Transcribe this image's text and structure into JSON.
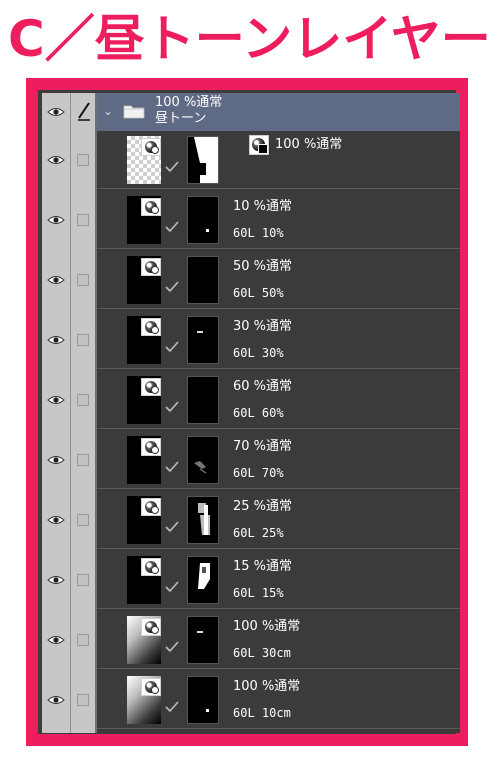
{
  "heading": "C／昼トーンレイヤー",
  "colors": {
    "accent": "#ee1e5e",
    "panel_bg": "#3b3b3b",
    "folder_bg": "#5f6a85"
  },
  "folder": {
    "opacity_mode": "100 %通常",
    "name": "昼トーン",
    "expanded": true
  },
  "layers": [
    {
      "line1": "100 %通常",
      "line2": "",
      "thumb": "checker",
      "mask": "fig1"
    },
    {
      "line1": "10 %通常",
      "line2": "60L 10%",
      "thumb": "black",
      "mask": "dot"
    },
    {
      "line1": "50 %通常",
      "line2": "60L 50%",
      "thumb": "black",
      "mask": "empty"
    },
    {
      "line1": "30 %通常",
      "line2": "60L 30%",
      "thumb": "black",
      "mask": "dash"
    },
    {
      "line1": "60 %通常",
      "line2": "60L 60%",
      "thumb": "black",
      "mask": "empty"
    },
    {
      "line1": "70 %通常",
      "line2": "60L 70%",
      "thumb": "black",
      "mask": "shade"
    },
    {
      "line1": "25 %通常",
      "line2": "60L 25%",
      "thumb": "black",
      "mask": "fig2"
    },
    {
      "line1": "15 %通常",
      "line2": "60L 15%",
      "thumb": "black",
      "mask": "fig3"
    },
    {
      "line1": "100 %通常",
      "line2": "60L 30cm",
      "thumb": "gradient",
      "mask": "dash"
    },
    {
      "line1": "100 %通常",
      "line2": "60L 10cm",
      "thumb": "gradient",
      "mask": "dot"
    }
  ],
  "icons": {
    "visibility": "eye-icon",
    "edit": "pencil-icon",
    "folder": "folder-icon",
    "tone": "tone-layer-icon",
    "link": "check-mark-icon"
  }
}
